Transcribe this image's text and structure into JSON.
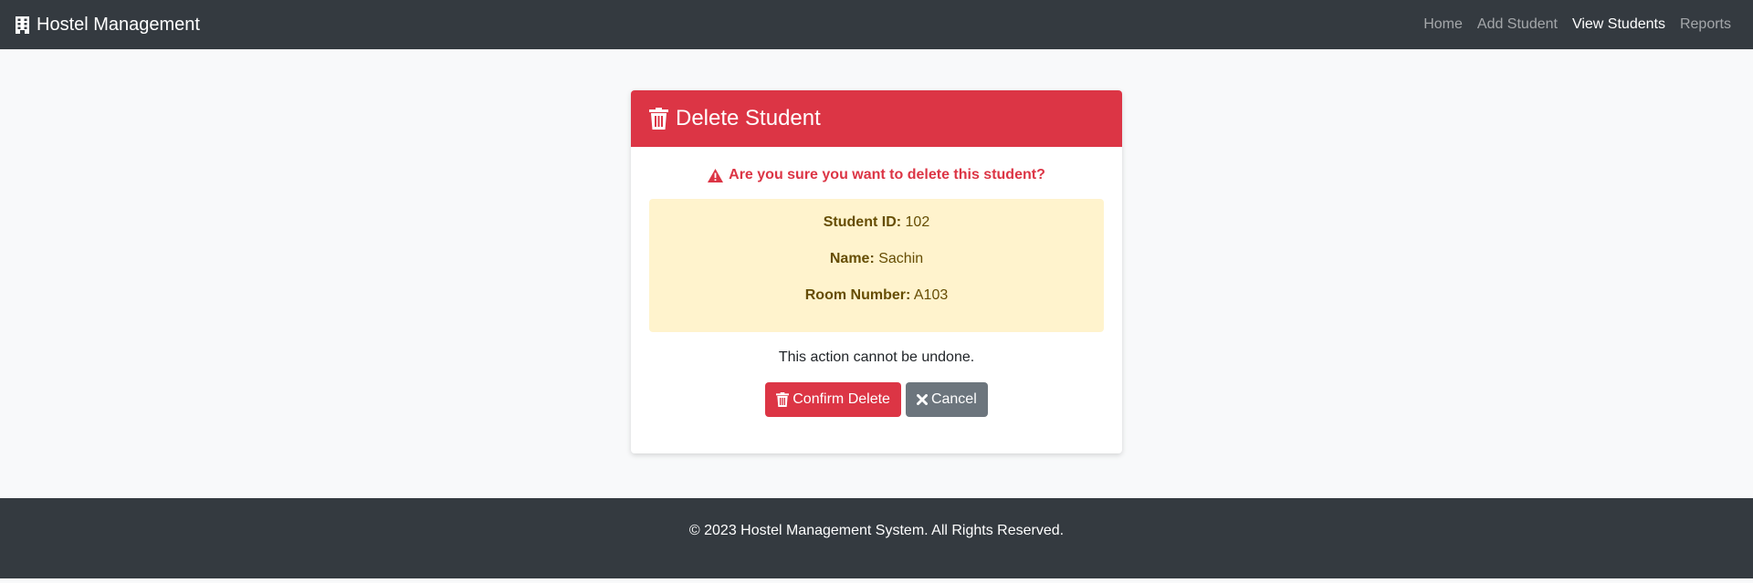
{
  "navbar": {
    "brand": "Hostel Management",
    "brand_icon": "building-icon",
    "links": [
      {
        "label": "Home",
        "active": false
      },
      {
        "label": "Add Student",
        "active": false
      },
      {
        "label": "View Students",
        "active": true
      },
      {
        "label": "Reports",
        "active": false
      }
    ]
  },
  "card": {
    "title": "Delete Student",
    "title_icon": "trash-icon",
    "warning": "Are you sure you want to delete this student?",
    "warning_icon": "warning-triangle-icon",
    "details": {
      "id_label": "Student ID:",
      "id_value": "102",
      "name_label": "Name:",
      "name_value": "Sachin",
      "room_label": "Room Number:",
      "room_value": "A103"
    },
    "note": "This action cannot be undone.",
    "confirm_label": "Confirm Delete",
    "cancel_label": "Cancel"
  },
  "footer": {
    "text": "© 2023 Hostel Management System. All Rights Reserved."
  },
  "colors": {
    "navbar": "#343a40",
    "danger": "#dc3545",
    "secondary": "#6c757d",
    "warning_bg": "#fff3cd",
    "warning_text": "#664d03",
    "page_bg": "#f8f9fa"
  }
}
